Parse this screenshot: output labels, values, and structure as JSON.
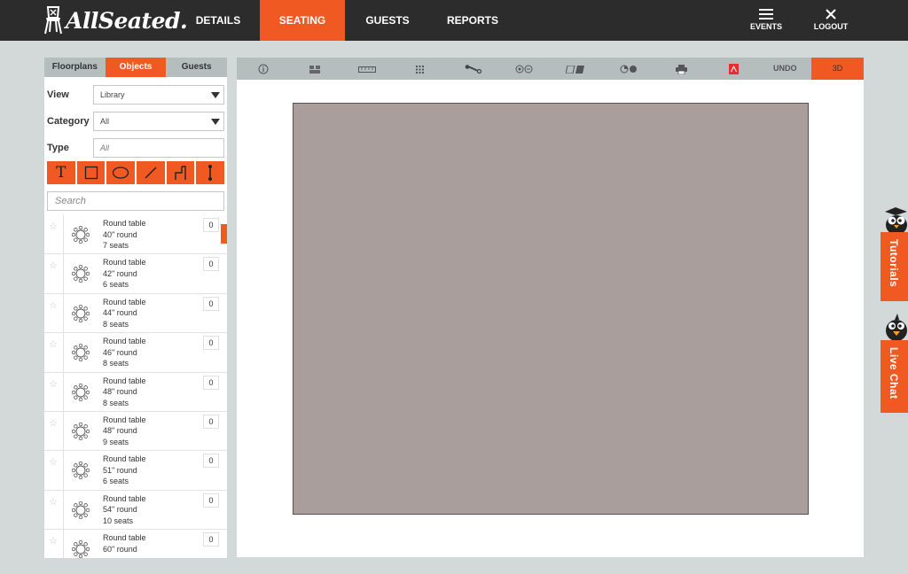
{
  "brand": {
    "name": "AllSeated."
  },
  "nav": {
    "items": [
      "DETAILS",
      "SEATING",
      "GUESTS",
      "REPORTS"
    ],
    "events": "EVENTS",
    "logout": "LOGOUT"
  },
  "leftPanel": {
    "tabs": [
      "Floorplans",
      "Objects",
      "Guests"
    ],
    "view": {
      "label": "View",
      "value": "Library"
    },
    "category": {
      "label": "Category",
      "value": "All"
    },
    "type": {
      "label": "Type",
      "value": "All"
    },
    "tools": {
      "text": "T"
    },
    "search": {
      "placeholder": "Search"
    },
    "items": [
      {
        "name": "Round table",
        "size": "40\" round",
        "seats": "7 seats",
        "qty": "0"
      },
      {
        "name": "Round table",
        "size": "42\" round",
        "seats": "6 seats",
        "qty": "0"
      },
      {
        "name": "Round table",
        "size": "44\" round",
        "seats": "8 seats",
        "qty": "0"
      },
      {
        "name": "Round table",
        "size": "46\" round",
        "seats": "8 seats",
        "qty": "0"
      },
      {
        "name": "Round table",
        "size": "48\" round",
        "seats": "8 seats",
        "qty": "0"
      },
      {
        "name": "Round table",
        "size": "48\" round",
        "seats": "9 seats",
        "qty": "0"
      },
      {
        "name": "Round table",
        "size": "51\" round",
        "seats": "6 seats",
        "qty": "0"
      },
      {
        "name": "Round table",
        "size": "54\" round",
        "seats": "10 seats",
        "qty": "0"
      },
      {
        "name": "Round table",
        "size": "60\" round",
        "seats": "",
        "qty": "0"
      }
    ]
  },
  "toolbar": {
    "undo": "UNDO",
    "view3d": "3D"
  },
  "sideTabs": {
    "tutorials": "Tutorials",
    "liveChat": "Live Chat"
  },
  "colors": {
    "accent": "#f05a22",
    "nav": "#2c2c2c",
    "canvas": "#aa9e9c",
    "toolbar": "#b5bdbd"
  }
}
